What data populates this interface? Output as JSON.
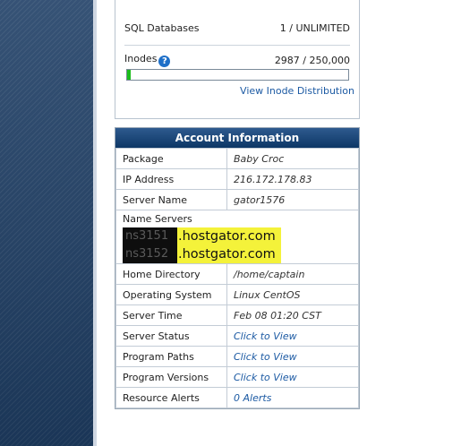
{
  "stats": {
    "sql_label": "SQL Databases",
    "sql_value": "1 / UNLIMITED",
    "inodes_label": "Inodes",
    "inodes_value": "2987 / 250,000",
    "inodes_fraction": 0.012,
    "inode_link": "View Inode Distribution"
  },
  "account": {
    "title": "Account Information",
    "rows": [
      {
        "label": "Package",
        "value": "Baby Croc"
      },
      {
        "label": "IP Address",
        "value": "216.172.178.83"
      },
      {
        "label": "Server Name",
        "value": "gator1576"
      },
      {
        "label": "Home Directory",
        "value": "/home/captain"
      },
      {
        "label": "Operating System",
        "value": "Linux CentOS"
      },
      {
        "label": "Server Time",
        "value": "Feb 08 01:20 CST"
      },
      {
        "label": "Server Status",
        "value": "Click to View"
      },
      {
        "label": "Program Paths",
        "value": "Click to View"
      },
      {
        "label": "Program Versions",
        "value": "Click to View"
      },
      {
        "label": "Resource Alerts",
        "value": "0 Alerts"
      }
    ],
    "name_servers": {
      "label": "Name Servers",
      "entries": [
        {
          "redacted": "ns3151",
          "host": ".hostgator.com"
        },
        {
          "redacted": "ns3152",
          "host": ".hostgator.com"
        }
      ]
    }
  },
  "colors": {
    "sidebar": "#1f3f66",
    "header": "#0d3766",
    "link": "#1c5aa3",
    "highlight": "#f4f23a",
    "progress": "#1bbd1b"
  }
}
